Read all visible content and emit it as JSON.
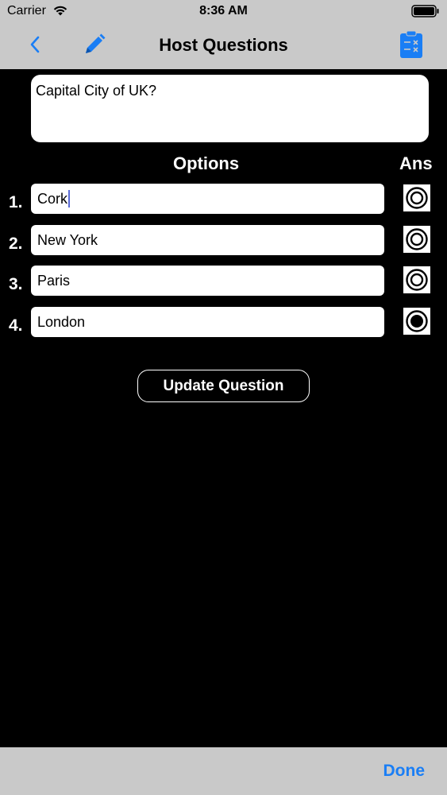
{
  "status_bar": {
    "carrier": "Carrier",
    "time": "8:36 AM"
  },
  "nav": {
    "title": "Host Questions",
    "accent_color": "#1a7ef5"
  },
  "question": {
    "text": "Capital City of UK?"
  },
  "headers": {
    "options": "Options",
    "ans": "Ans"
  },
  "options": [
    {
      "number": "1.",
      "value": "Cork",
      "selected": false
    },
    {
      "number": "2.",
      "value": "New York",
      "selected": false
    },
    {
      "number": "3.",
      "value": "Paris",
      "selected": false
    },
    {
      "number": "4.",
      "value": "London",
      "selected": true
    }
  ],
  "update_button": {
    "label": "Update Question"
  },
  "bottom_bar": {
    "done_label": "Done"
  }
}
